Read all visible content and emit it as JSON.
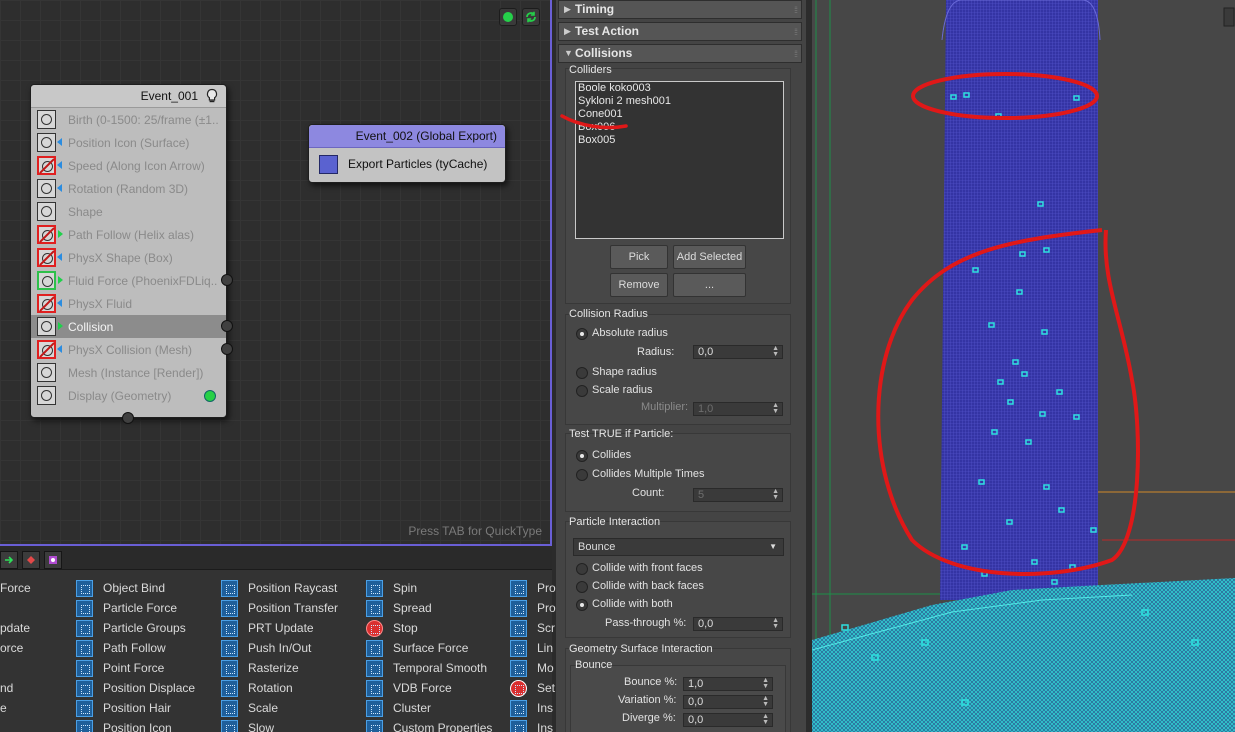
{
  "editor": {
    "quicktype_hint": "Press TAB for QuickType",
    "event1": {
      "title": "Event_001",
      "operators": [
        {
          "label": "Birth (0-1500: 25/frame (±1...",
          "icon": "birth-icon",
          "style": "normal"
        },
        {
          "label": "Position Icon (Surface)",
          "icon": "position-icon",
          "style": "normal"
        },
        {
          "label": "Speed (Along Icon Arrow)",
          "icon": "speed-icon",
          "style": "disabled"
        },
        {
          "label": "Rotation (Random 3D)",
          "icon": "rotation-icon",
          "style": "normal"
        },
        {
          "label": "Shape",
          "icon": "shape-icon",
          "style": "normal"
        },
        {
          "label": "Path Follow (Helix alas)",
          "icon": "path-follow-icon",
          "style": "disabled"
        },
        {
          "label": "PhysX Shape (Box)",
          "icon": "physx-shape-icon",
          "style": "disabled"
        },
        {
          "label": "Fluid Force (PhoenixFDLiq...",
          "icon": "fluid-force-icon",
          "style": "test"
        },
        {
          "label": "PhysX Fluid",
          "icon": "physx-fluid-icon",
          "style": "disabled"
        },
        {
          "label": "Collision",
          "icon": "collision-icon",
          "style": "selected"
        },
        {
          "label": "PhysX Collision (Mesh)",
          "icon": "physx-collision-icon",
          "style": "disabled"
        },
        {
          "label": "Mesh (Instance [Render])",
          "icon": "mesh-icon",
          "style": "normal"
        },
        {
          "label": "Display (Geometry)",
          "icon": "display-icon",
          "style": "normal"
        }
      ]
    },
    "event2": {
      "title": "Event_002 (Global Export)",
      "operators": [
        {
          "label": "Export Particles (tyCache)",
          "icon": "export-particles-icon"
        }
      ]
    }
  },
  "depot": {
    "columns": [
      [
        "Force",
        "",
        "pdate",
        "orce",
        "",
        "nd",
        "e"
      ],
      [
        "Object Bind",
        "Particle Force",
        "Particle Groups",
        "Path Follow",
        "Point Force",
        "Position Displace",
        "Position Hair",
        "Position Icon"
      ],
      [
        "Position Raycast",
        "Position Transfer",
        "PRT Update",
        "Push In/Out",
        "Rasterize",
        "Rotation",
        "Scale",
        "Slow"
      ],
      [
        "Spin",
        "Spread",
        "Stop",
        "Surface Force",
        "Temporal Smooth",
        "VDB Force",
        "Cluster",
        "Custom Properties"
      ],
      [
        "Pro",
        "Pro",
        "Scr",
        "Lin",
        "Mo",
        "Set",
        "Ins",
        "Ins"
      ]
    ]
  },
  "props": {
    "rollouts": {
      "timing": "Timing",
      "test_action": "Test Action",
      "collisions": "Collisions"
    },
    "colliders": {
      "title": "Colliders",
      "items": [
        "Boole koko003",
        "Sykloni 2 mesh001",
        "Cone001",
        "Box006",
        "Box005"
      ],
      "buttons": {
        "pick": "Pick",
        "add_selected": "Add Selected",
        "remove": "Remove",
        "more": "..."
      }
    },
    "collision_radius": {
      "title": "Collision Radius",
      "absolute": "Absolute radius",
      "radius_label": "Radius:",
      "radius_value": "0,0",
      "shape": "Shape radius",
      "scale": "Scale radius",
      "multiplier_label": "Multiplier:",
      "multiplier_value": "1,0"
    },
    "test_true": {
      "title": "Test TRUE if Particle:",
      "collides": "Collides",
      "multiple": "Collides Multiple Times",
      "count_label": "Count:",
      "count_value": "5"
    },
    "particle_interaction": {
      "title": "Particle Interaction",
      "mode": "Bounce",
      "front": "Collide with front faces",
      "back": "Collide with back faces",
      "both": "Collide with both",
      "pass_label": "Pass-through %:",
      "pass_value": "0,0"
    },
    "geometry": {
      "title": "Geometry Surface Interaction",
      "bounce_group": "Bounce",
      "bounce_label": "Bounce %:",
      "bounce_value": "1,0",
      "variation_label": "Variation %:",
      "variation_value": "0,0",
      "diverge_label": "Diverge %:",
      "diverge_value": "0,0"
    }
  },
  "colors": {
    "accent": "#6a5fd6",
    "annotation": "#e01818",
    "particles": "#19e3e3",
    "mesh": "#3a3aa8"
  }
}
